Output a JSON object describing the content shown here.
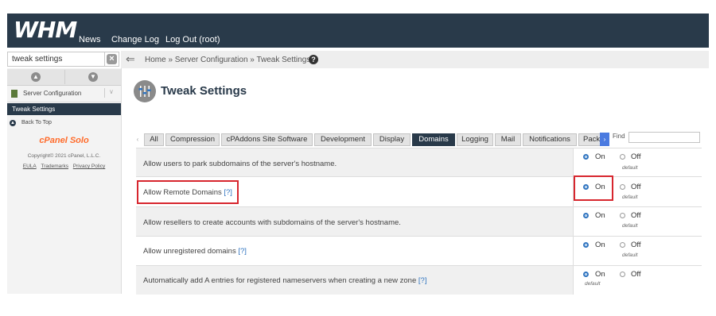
{
  "header": {
    "logo": "WHM",
    "nav": [
      "News",
      "Change Log",
      "Log Out (root)"
    ]
  },
  "search": {
    "value": "tweak settings",
    "clear_icon": "×"
  },
  "breadcrumb": {
    "text": "Home » Server Configuration » Tweak Settings",
    "help_icon": "?"
  },
  "sidebar": {
    "category_label": "Server Configuration",
    "active_item": "Tweak Settings",
    "back_label": "Back To Top",
    "brand": "cPanel Solo",
    "copyright": "Copyright© 2021 cPanel, L.L.C.",
    "links": [
      "EULA",
      "Trademarks",
      "Privacy Policy"
    ]
  },
  "page": {
    "title": "Tweak Settings"
  },
  "tabs": {
    "items": [
      "All",
      "Compression",
      "cPAddons Site Software",
      "Development",
      "Display",
      "Domains",
      "Logging",
      "Mail",
      "Notifications",
      "Pack"
    ],
    "active": "Domains",
    "find_label": "Find",
    "left_arrow": "‹",
    "right_arrow": "›"
  },
  "settings": [
    {
      "label": "Allow users to park subdomains of the server's hostname.",
      "help": "",
      "value": "On",
      "default": "Off",
      "highlight": false
    },
    {
      "label": "Allow Remote Domains",
      "help": "[?]",
      "value": "On",
      "default": "Off",
      "highlight": true
    },
    {
      "label": "Allow resellers to create accounts with subdomains of the server's hostname.",
      "help": "",
      "value": "On",
      "default": "Off",
      "highlight": false
    },
    {
      "label": "Allow unregistered domains",
      "help": "[?]",
      "value": "On",
      "default": "Off",
      "highlight": false
    },
    {
      "label": "Automatically add A entries for registered nameservers when creating a new zone",
      "help": "[?]",
      "value": "On",
      "default": "On",
      "highlight": false
    }
  ],
  "radio_labels": {
    "on": "On",
    "off": "Off",
    "default": "default"
  },
  "colors": {
    "header_bg": "#293a4a",
    "highlight": "#d7262e",
    "accent": "#2f74c0",
    "brand": "#ff6c2c"
  }
}
